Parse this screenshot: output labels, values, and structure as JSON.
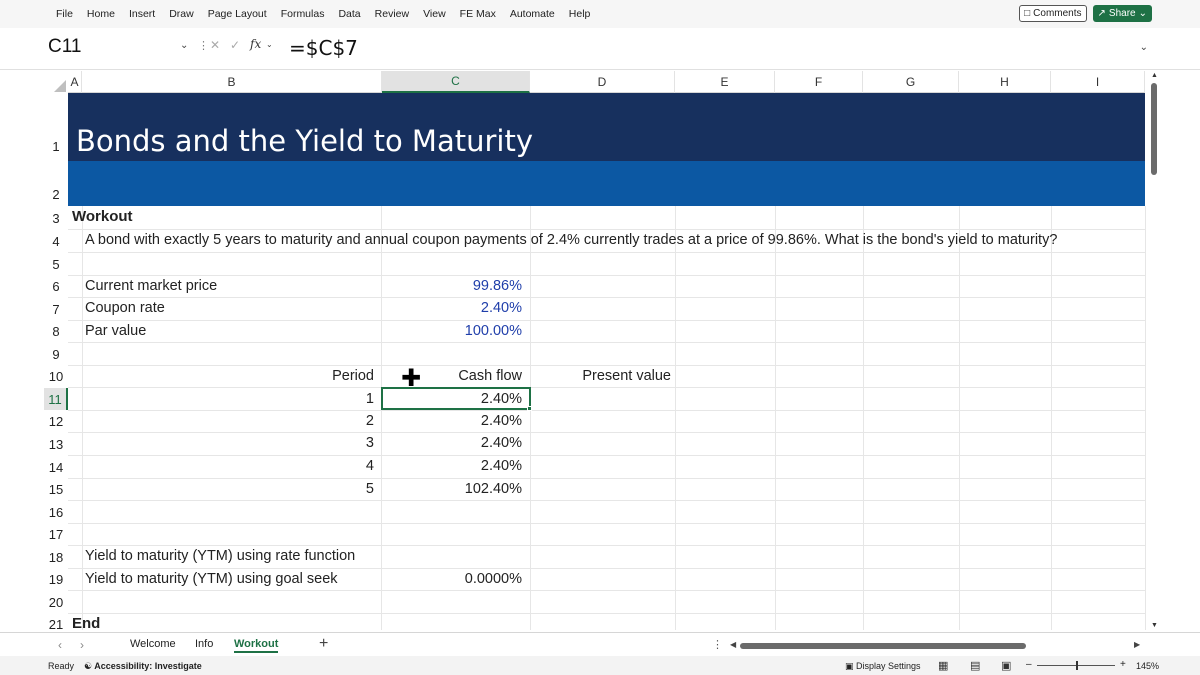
{
  "menu": [
    "File",
    "Home",
    "Insert",
    "Draw",
    "Page Layout",
    "Formulas",
    "Data",
    "Review",
    "View",
    "FE Max",
    "Automate",
    "Help"
  ],
  "actions": {
    "comments": "Comments",
    "share": "Share"
  },
  "formula_bar": {
    "name_box": "C11",
    "formula": "=$C$7",
    "fx": "fx"
  },
  "columns": [
    "A",
    "B",
    "C",
    "D",
    "E",
    "F",
    "G",
    "H",
    "I"
  ],
  "rows": [
    "1",
    "2",
    "3",
    "4",
    "5",
    "6",
    "7",
    "8",
    "9",
    "10",
    "11",
    "12",
    "13",
    "14",
    "15",
    "16",
    "17",
    "18",
    "19",
    "20",
    "21"
  ],
  "sheet": {
    "title": "Bonds and the Yield to Maturity",
    "section": "Workout",
    "question": "A bond with exactly 5 years to maturity and annual coupon payments of 2.4% currently trades at a price of 99.86%. What is the bond's yield to maturity?",
    "inputs": [
      {
        "label": "Current market price",
        "value": "99.86%"
      },
      {
        "label": "Coupon rate",
        "value": "2.40%"
      },
      {
        "label": "Par value",
        "value": "100.00%"
      }
    ],
    "headers": {
      "period": "Period",
      "cash_flow": "Cash flow",
      "present_value": "Present value"
    },
    "schedule": [
      {
        "period": "1",
        "cash_flow": "2.40%"
      },
      {
        "period": "2",
        "cash_flow": "2.40%"
      },
      {
        "period": "3",
        "cash_flow": "2.40%"
      },
      {
        "period": "4",
        "cash_flow": "2.40%"
      },
      {
        "period": "5",
        "cash_flow": "102.40%"
      }
    ],
    "ytm_rate_label": "Yield to maturity (YTM) using rate function",
    "ytm_goal_label": "Yield to maturity (YTM) using goal seek",
    "ytm_goal_value": "0.0000%",
    "end": "End"
  },
  "tabs": {
    "items": [
      "Welcome",
      "Info",
      "Workout"
    ],
    "active": "Workout",
    "add": "+"
  },
  "status": {
    "ready": "Ready",
    "accessibility": "Accessibility: Investigate",
    "display": "Display Settings",
    "zoom": "145%"
  }
}
